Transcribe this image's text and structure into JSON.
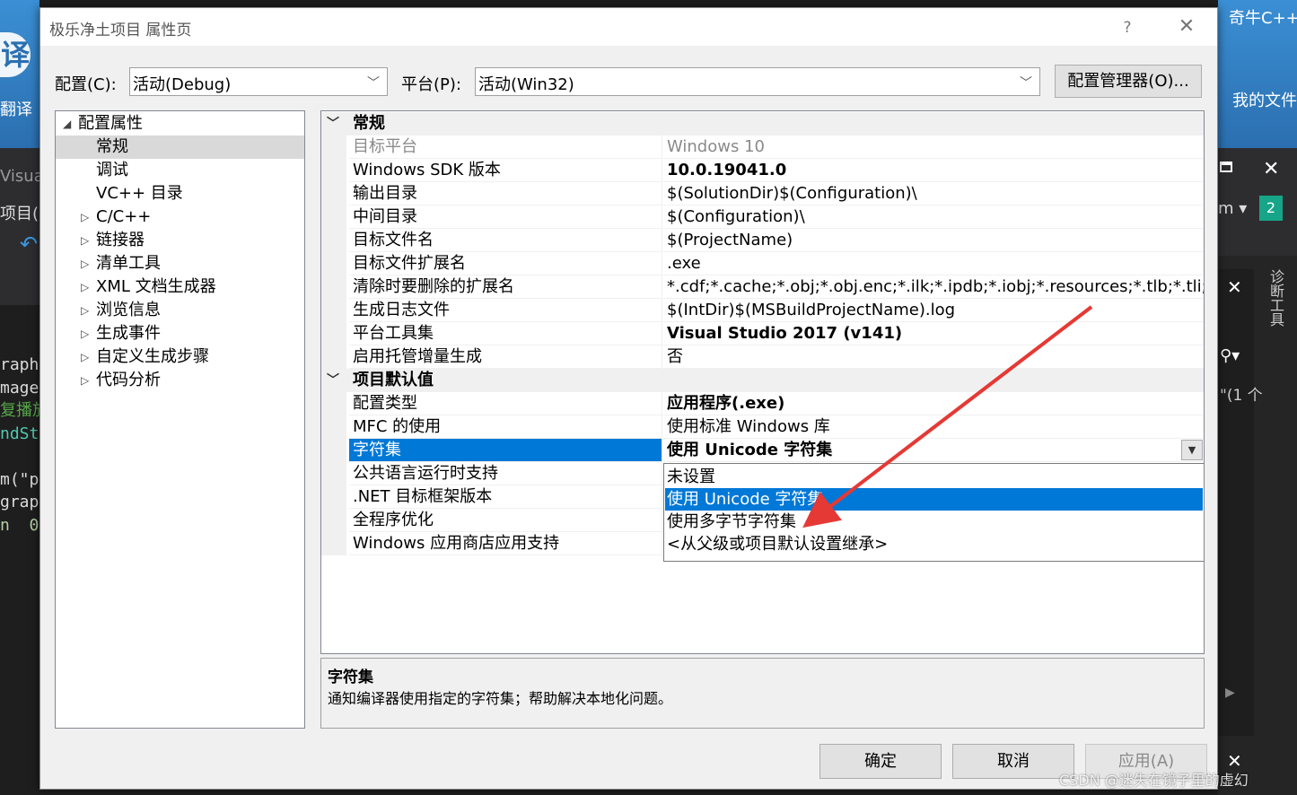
{
  "dialog": {
    "title": "极乐净土项目 属性页",
    "help": "?",
    "close": "✕"
  },
  "config": {
    "config_label": "配置(C):",
    "config_value": "活动(Debug)",
    "platform_label": "平台(P):",
    "platform_value": "活动(Win32)",
    "manager_button": "配置管理器(O)..."
  },
  "tree": {
    "root": "配置属性",
    "items": [
      "常规",
      "调试",
      "VC++ 目录",
      "C/C++",
      "链接器",
      "清单工具",
      "XML 文档生成器",
      "浏览信息",
      "生成事件",
      "自定义生成步骤",
      "代码分析"
    ],
    "selected": "常规"
  },
  "grid": {
    "categories": [
      "常规",
      "项目默认值"
    ],
    "general_rows": [
      {
        "name": "目标平台",
        "value": "Windows 10"
      },
      {
        "name": "Windows SDK 版本",
        "value": "10.0.19041.0"
      },
      {
        "name": "输出目录",
        "value": "$(SolutionDir)$(Configuration)\\"
      },
      {
        "name": "中间目录",
        "value": "$(Configuration)\\"
      },
      {
        "name": "目标文件名",
        "value": "$(ProjectName)"
      },
      {
        "name": "目标文件扩展名",
        "value": ".exe"
      },
      {
        "name": "清除时要删除的扩展名",
        "value": "*.cdf;*.cache;*.obj;*.obj.enc;*.ilk;*.ipdb;*.iobj;*.resources;*.tlb;*.tli;*.tlh;*.tmp;*.rsp"
      },
      {
        "name": "生成日志文件",
        "value": "$(IntDir)$(MSBuildProjectName).log"
      },
      {
        "name": "平台工具集",
        "value": "Visual Studio 2017 (v141)"
      },
      {
        "name": "启用托管增量生成",
        "value": "否"
      }
    ],
    "default_rows": [
      {
        "name": "配置类型",
        "value": "应用程序(.exe)"
      },
      {
        "name": "MFC 的使用",
        "value": "使用标准 Windows 库"
      },
      {
        "name": "字符集",
        "value": "使用 Unicode 字符集"
      },
      {
        "name": "公共语言运行时支持",
        "value": ""
      },
      {
        "name": ".NET 目标框架版本",
        "value": ""
      },
      {
        "name": "全程序优化",
        "value": ""
      },
      {
        "name": "Windows 应用商店应用支持",
        "value": ""
      }
    ],
    "dropdown_options": [
      "未设置",
      "使用 Unicode 字符集",
      "使用多字节字符集",
      "<从父级或项目默认设置继承>"
    ],
    "dropdown_selected": "使用 Unicode 字符集"
  },
  "description": {
    "title": "字符集",
    "text": "通知编译器使用指定的字符集；帮助解决本地化问题。"
  },
  "buttons": {
    "ok": "确定",
    "cancel": "取消",
    "apply": "应用(A)"
  },
  "background": {
    "desktop_left_label": "翻译",
    "desktop_right_label1": "奇牛C++",
    "desktop_right_label2": "我的文件",
    "vs_title": "Visual",
    "vs_project": "项目(",
    "side_badge": "2",
    "side_panel_title": "诊断工具",
    "side_quote": "\"(1 个",
    "code_lines": [
      "raph",
      "mage",
      "复播放",
      "ndSt",
      "",
      "m(\"p",
      "grap",
      "n  0"
    ]
  },
  "watermark": "CSDN @迷失在镜子里的虚幻",
  "annotation_color": "#e53935"
}
